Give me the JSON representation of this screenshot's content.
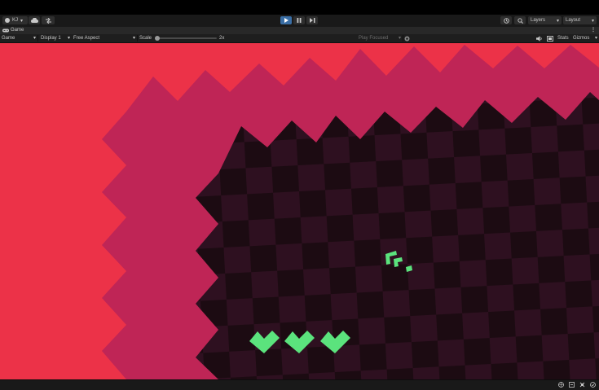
{
  "toolbar": {
    "account_label": "KJ",
    "layers_label": "Layers",
    "layout_label": "Layout"
  },
  "tab": {
    "title": "Game"
  },
  "controls": {
    "view_mode": "Game",
    "display": "Display 1",
    "aspect": "Free Aspect",
    "scale_label": "Scale",
    "scale_value": "2x",
    "play_mode": "Play Focused",
    "stats_label": "Stats",
    "gizmos_label": "Gizmos"
  },
  "colors": {
    "background_red": "#ec3248",
    "zigzag_magenta": "#bf2556",
    "floor_dark": "#1c0b12",
    "floor_light": "#2e1020",
    "player_green": "#5be37d",
    "play_button_active": "#3a6ea5"
  },
  "game": {
    "lives": 3,
    "life_icon": "heart-icon"
  }
}
